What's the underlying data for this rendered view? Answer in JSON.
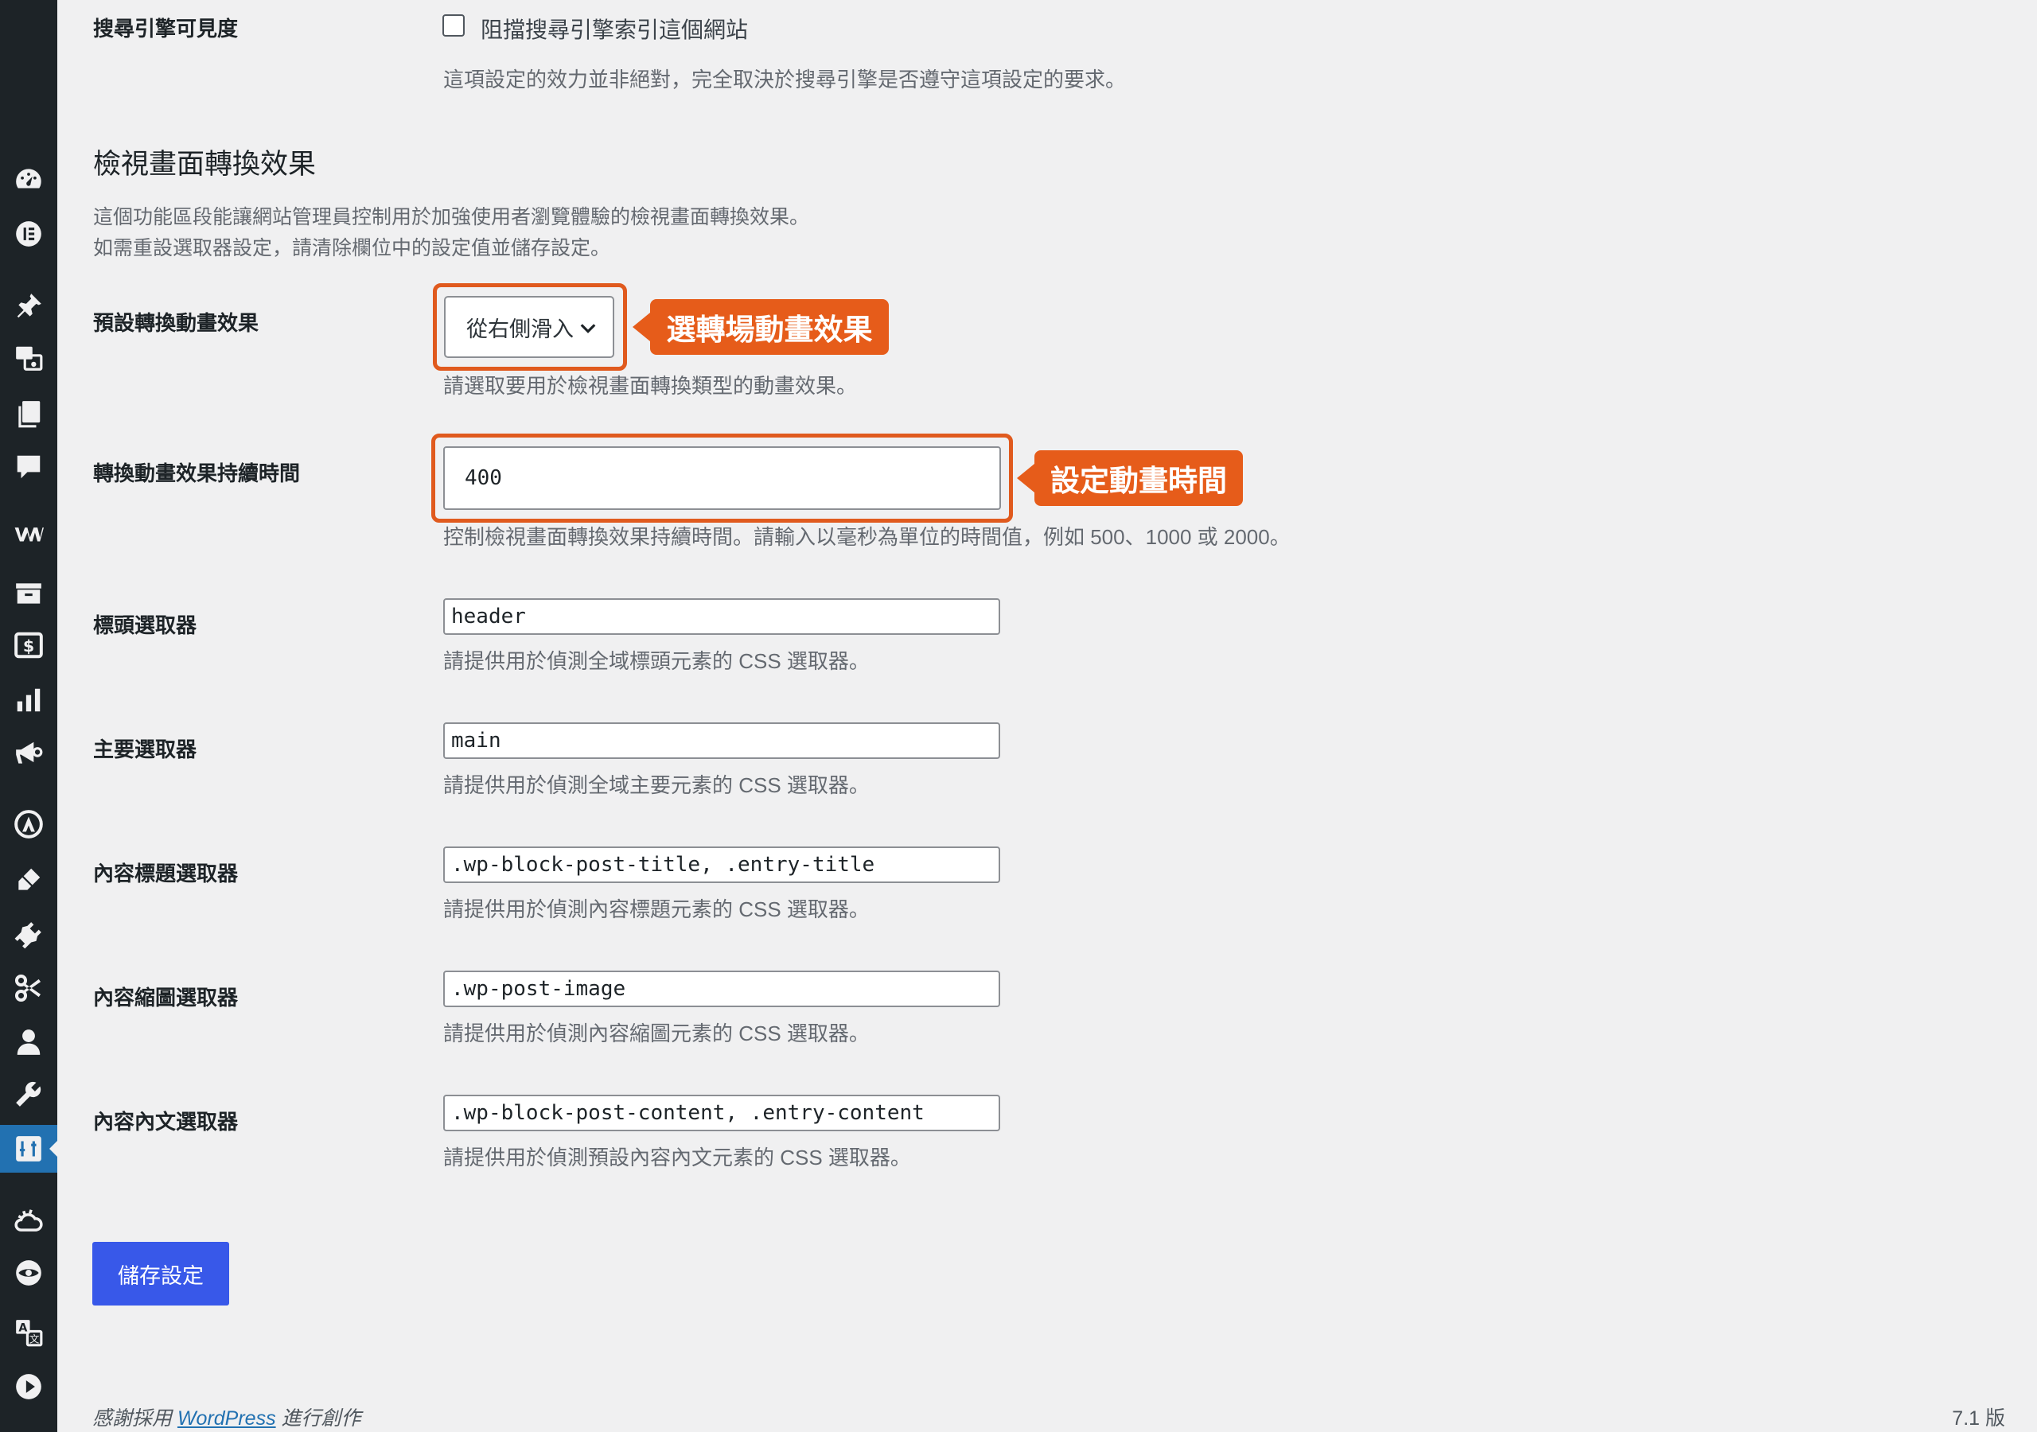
{
  "search_visibility": {
    "label": "搜尋引擎可見度",
    "checkbox_label": "阻擋搜尋引擎索引這個網站",
    "checked": false,
    "description": "這項設定的效力並非絕對，完全取決於搜尋引擎是否遵守這項設定的要求。"
  },
  "section": {
    "title": "檢視畫面轉換效果",
    "desc_line1": "這個功能區段能讓網站管理員控制用於加強使用者瀏覽體驗的檢視畫面轉換效果。",
    "desc_line2": "如需重設選取器設定，請清除欄位中的設定值並儲存設定。"
  },
  "animation": {
    "label": "預設轉換動畫效果",
    "selected": "從右側滑入",
    "description": "請選取要用於檢視畫面轉換類型的動畫效果。",
    "callout": "選轉場動畫效果"
  },
  "duration": {
    "label": "轉換動畫效果持續時間",
    "value": "400",
    "description": "控制檢視畫面轉換效果持續時間。請輸入以毫秒為單位的時間值，例如 500、1000 或 2000。",
    "callout": "設定動畫時間"
  },
  "selectors": [
    {
      "label": "標頭選取器",
      "value": "header",
      "description": "請提供用於偵測全域標頭元素的 CSS 選取器。"
    },
    {
      "label": "主要選取器",
      "value": "main",
      "description": "請提供用於偵測全域主要元素的 CSS 選取器。"
    },
    {
      "label": "內容標題選取器",
      "value": ".wp-block-post-title, .entry-title",
      "description": "請提供用於偵測內容標題元素的 CSS 選取器。"
    },
    {
      "label": "內容縮圖選取器",
      "value": ".wp-post-image",
      "description": "請提供用於偵測內容縮圖元素的 CSS 選取器。"
    },
    {
      "label": "內容內文選取器",
      "value": ".wp-block-post-content, .entry-content",
      "description": "請提供用於偵測預設內容內文元素的 CSS 選取器。"
    }
  ],
  "save_button": "儲存設定",
  "footer": {
    "thanks_prefix": "感謝採用 ",
    "wordpress_link": "WordPress",
    "thanks_suffix": " 進行創作",
    "version": "7.1 版"
  },
  "colors": {
    "sidebar_bg": "#1d2327",
    "active_menu": "#2271b1",
    "primary_button": "#3858e9",
    "callout": "#e65c1a"
  },
  "sidebar_icons": [
    "dashboard-icon",
    "elementor-icon",
    "pin-icon",
    "media-icon",
    "pages-icon",
    "comments-icon",
    "woocommerce-icon",
    "archive-icon",
    "payments-icon",
    "analytics-icon",
    "marketing-icon",
    "astra-icon",
    "appearance-icon",
    "plugins-icon",
    "scissors-icon",
    "users-icon",
    "tools-icon",
    "settings-icon",
    "cloud-icon",
    "eye-icon",
    "translate-icon",
    "play-icon"
  ]
}
